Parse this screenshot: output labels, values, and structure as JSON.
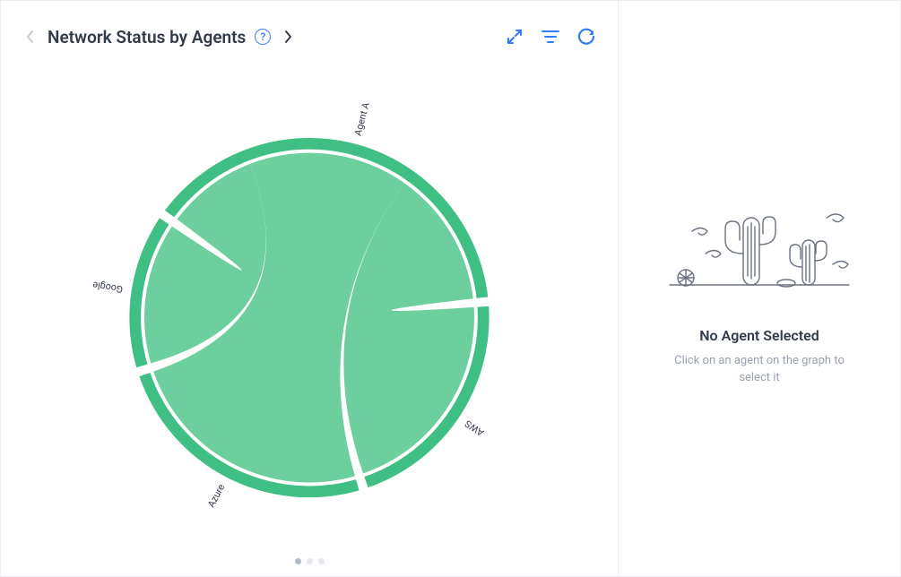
{
  "header": {
    "title": "Network Status by Agents",
    "help_symbol": "?"
  },
  "sidebar": {
    "title": "No Agent Selected",
    "subtitle": "Click on an agent on the graph to select it"
  },
  "pager": {
    "count": 3,
    "active": 0
  },
  "colors": {
    "ribbon": "#66cc99",
    "arc": "#3fbf83",
    "accent": "#2f7cf6"
  },
  "chart_data": {
    "type": "chord",
    "title": "Network Status by Agents",
    "nodes": [
      {
        "name": "Agent A",
        "size": 110
      },
      {
        "name": "AWS",
        "size": 60
      },
      {
        "name": "Azure",
        "size": 70
      },
      {
        "name": "Google",
        "size": 40
      }
    ],
    "links": [
      {
        "source": "Agent A",
        "target": "Google",
        "value": 40
      },
      {
        "source": "Agent A",
        "target": "Azure",
        "value": 70
      },
      {
        "source": "Agent A",
        "target": "AWS",
        "value": 60
      }
    ],
    "status_color": "healthy"
  }
}
